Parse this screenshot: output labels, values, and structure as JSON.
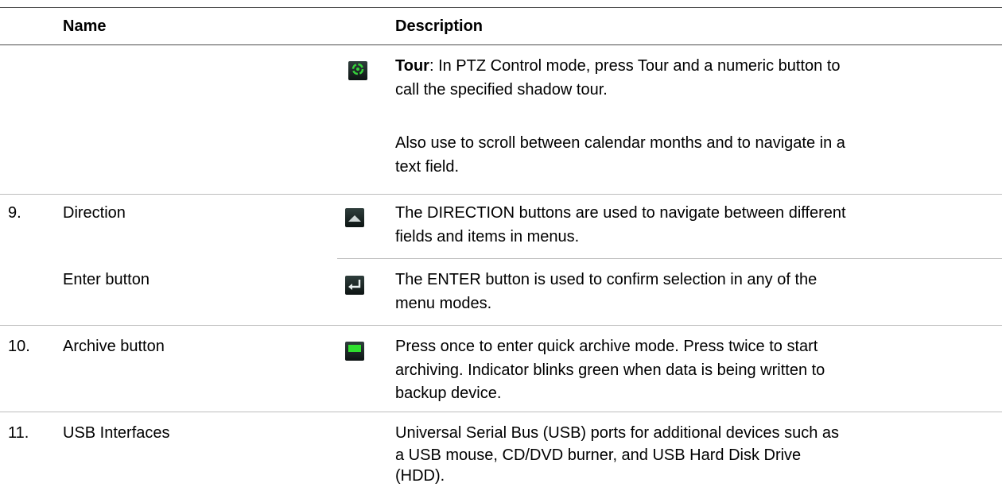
{
  "header": {
    "name": "Name",
    "description": "Description"
  },
  "tour": {
    "icon": "tour-icon",
    "term": "Tour",
    "rest_line1": ": In PTZ Control mode, press Tour and a numeric button to",
    "line2": "call the specified shadow tour.",
    "note_line1": "Also use to scroll between calendar months and to navigate in a",
    "note_line2": "text field."
  },
  "rows": [
    {
      "number": "9.",
      "name": "Direction",
      "icon": "direction-up-icon",
      "desc_line1": "The DIRECTION buttons are used to navigate between different",
      "desc_line2": "fields and items in menus."
    },
    {
      "number": "",
      "name": "Enter button",
      "icon": "enter-icon",
      "desc_line1": "The ENTER button is used to confirm selection in any of the",
      "desc_line2": "menu modes."
    },
    {
      "number": "10.",
      "name": "Archive button",
      "icon": "archive-icon",
      "desc_line1": "Press once to enter quick archive mode. Press twice to start",
      "desc_line2": "archiving. Indicator blinks green when data is being written to",
      "desc_line3": "backup device."
    },
    {
      "number": "11.",
      "name": "USB Interfaces",
      "icon": "",
      "desc_line1": "Universal Serial Bus (USB) ports for additional devices such as",
      "desc_line2": "a USB mouse, CD/DVD burner, and USB Hard Disk Drive",
      "desc_line3": "(HDD)."
    }
  ],
  "colors": {
    "icon_bg": "#1a2524",
    "tour_green": "#35d23a",
    "archive_green": "#2ee02e",
    "rule": "#bdbdbd"
  }
}
